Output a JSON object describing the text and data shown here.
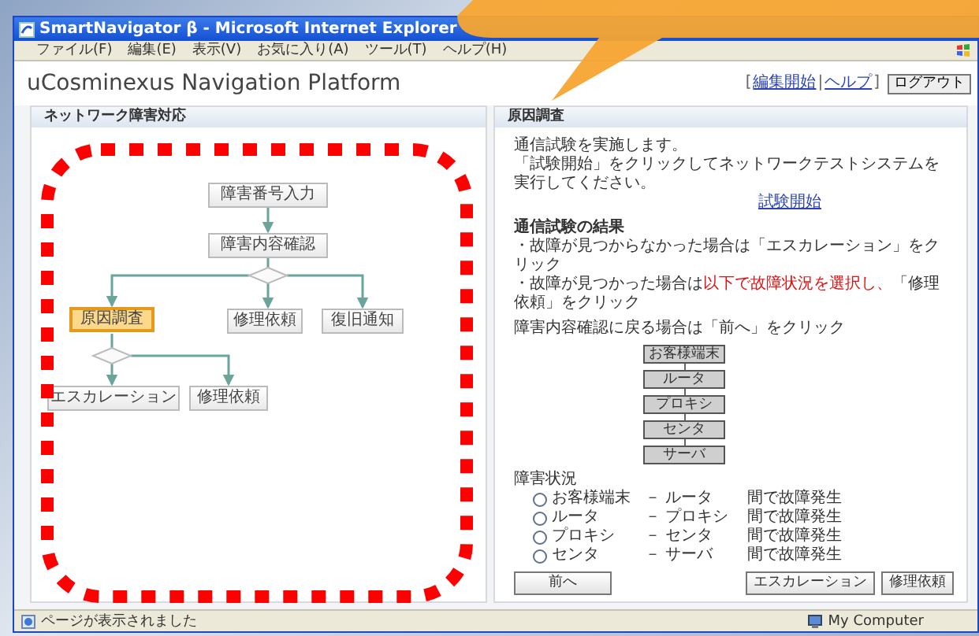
{
  "window": {
    "title": "SmartNavigator β - Microsoft Internet Explorer"
  },
  "menu": [
    "ファイル(F)",
    "編集(E)",
    "表示(V)",
    "お気に入り(A)",
    "ツール(T)",
    "ヘルプ(H)"
  ],
  "app": {
    "title": "uCosminexus Navigation Platform",
    "header_links": [
      {
        "kind": "text",
        "text": "["
      },
      {
        "kind": "link",
        "text": "編集開始"
      },
      {
        "kind": "text",
        "text": "|"
      },
      {
        "kind": "link",
        "text": "ヘルプ"
      },
      {
        "kind": "text",
        "text": "]"
      }
    ],
    "logout": "ログアウト"
  },
  "left_panel": {
    "title": "ネットワーク障害対応",
    "flow_nodes": [
      {
        "label": "障害番号入力",
        "selected": false
      },
      {
        "label": "障害内容確認",
        "selected": false
      },
      {
        "label": "原因調査",
        "selected": true
      },
      {
        "label": "修理依頼",
        "selected": false
      },
      {
        "label": "復旧通知",
        "selected": false
      },
      {
        "label": "エスカレーション",
        "selected": false
      },
      {
        "label": "修理依頼",
        "selected": false
      }
    ]
  },
  "right_panel": {
    "title": "原因調査",
    "intro": [
      "通信試験を実施します。",
      "「試験開始」をクリックしてネットワークテストシステムを",
      "実行してください。"
    ],
    "start_link": "試験開始",
    "result_heading": "通信試験の結果",
    "bullets": [
      [
        {
          "text": "・故障が見つからなかった場合は「エスカレーション」をクリック",
          "highlight": false
        }
      ],
      [
        {
          "text": "・故障が見つかった場合は",
          "highlight": false
        },
        {
          "text": "以下で故障状況を選択し、",
          "highlight": true
        },
        {
          "text": "「修理依頼」をクリック",
          "highlight": false
        }
      ]
    ],
    "back_note": "障害内容確認に戻る場合は「前へ」をクリック",
    "chain": [
      "お客様端末",
      "ルータ",
      "プロキシ",
      "センタ",
      "サーバ"
    ],
    "status_label": "障害状況",
    "options": [
      {
        "from": "お客様端末",
        "to": "－ ルータ",
        "suffix": "間で故障発生",
        "selected": false
      },
      {
        "from": "ルータ",
        "to": "－ プロキシ",
        "suffix": "間で故障発生",
        "selected": false
      },
      {
        "from": "プロキシ",
        "to": "－ センタ",
        "suffix": "間で故障発生",
        "selected": false
      },
      {
        "from": "センタ",
        "to": "－ サーバ",
        "suffix": "間で故障発生",
        "selected": false
      }
    ],
    "back_button": "前へ",
    "action_buttons": [
      "エスカレーション",
      "修理依頼"
    ]
  },
  "status_bar": {
    "text": "ページが表示されました",
    "zone": "My Computer"
  }
}
